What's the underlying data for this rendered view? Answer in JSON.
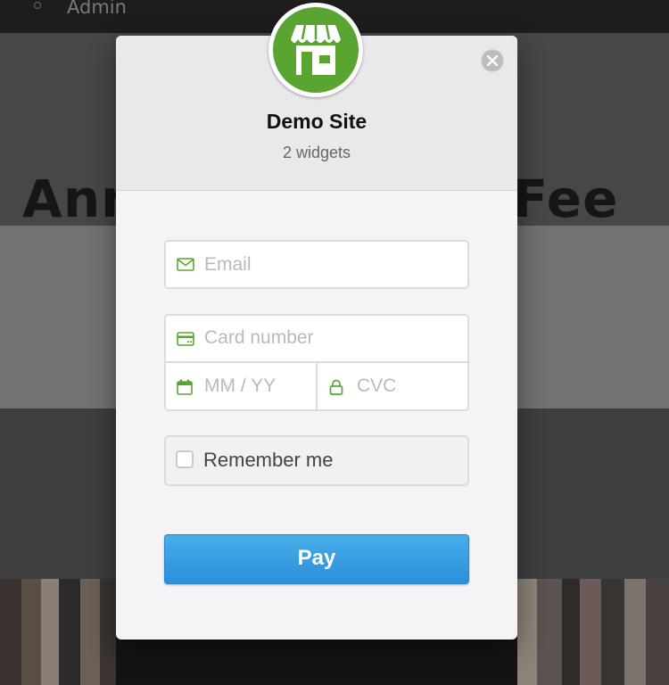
{
  "background": {
    "nav_item": "Admin",
    "heading_left": "Ann",
    "heading_right": "Fee"
  },
  "modal": {
    "site_name": "Demo Site",
    "subtitle": "2 widgets",
    "logo_icon": "storefront-icon",
    "close_icon": "close-icon"
  },
  "form": {
    "email": {
      "placeholder": "Email",
      "value": "",
      "icon": "envelope-icon"
    },
    "card_number": {
      "placeholder": "Card number",
      "value": "",
      "icon": "credit-card-icon"
    },
    "expiry": {
      "placeholder": "MM / YY",
      "value": "",
      "icon": "calendar-icon"
    },
    "cvc": {
      "placeholder": "CVC",
      "value": "",
      "icon": "lock-icon"
    },
    "remember": {
      "label": "Remember me",
      "checked": false
    },
    "pay_label": "Pay"
  },
  "colors": {
    "accent_green": "#5aa532",
    "pay_blue": "#3a9fe3"
  }
}
